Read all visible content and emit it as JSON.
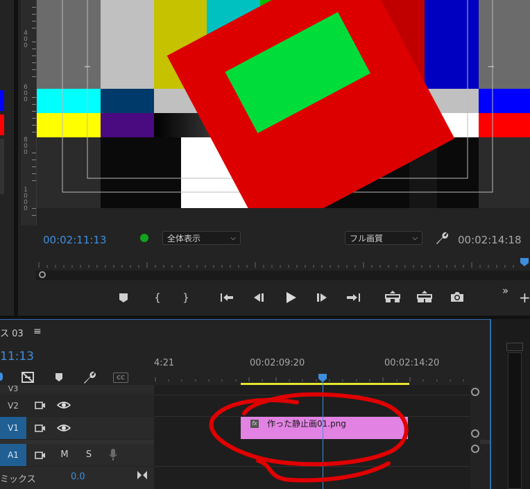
{
  "monitor": {
    "current_time": "00:02:11:13",
    "duration": "00:02:14:18",
    "zoom_select": "全体表示",
    "quality_select": "フル画質",
    "ruler_labels": [
      "400",
      "600",
      "800",
      "1000"
    ]
  },
  "transport": {
    "marker_icon": "marker-icon",
    "in_icon": "mark-in-icon",
    "out_icon": "mark-out-icon",
    "goto_in_icon": "go-to-in-icon",
    "step_back_icon": "step-back-icon",
    "play_icon": "play-icon",
    "step_fwd_icon": "step-forward-icon",
    "goto_out_icon": "go-to-out-icon",
    "lift_icon": "lift-icon",
    "extract_icon": "extract-icon",
    "camera_icon": "export-frame-icon",
    "more": "»",
    "add": "+"
  },
  "sequence": {
    "tab_name": "ス 03",
    "timecode": "11:13",
    "ruler_times": [
      "4:21",
      "00:02:09:20",
      "00:02:14:20"
    ],
    "tracks": {
      "v3": "V3",
      "v2": "V2",
      "v1": "V1",
      "a1": "A1",
      "m": "M",
      "s": "S",
      "mix_label": "ミックス",
      "mix_value": "0.0"
    },
    "clip": {
      "fx": "fx",
      "name": "作った静止画01.png",
      "color": "#e283e3"
    }
  },
  "colors": {
    "accent_blue": "#3d8fde",
    "annotation_red": "#e00000",
    "work_area_yellow": "#e6e62e"
  }
}
